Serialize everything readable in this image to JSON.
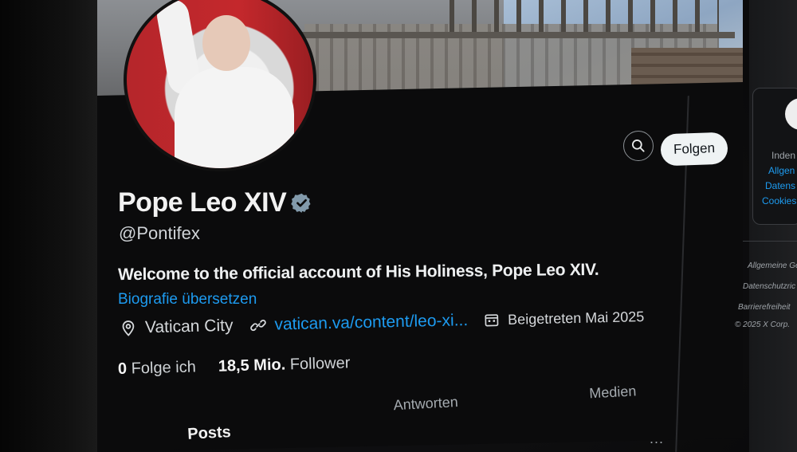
{
  "profile": {
    "display_name": "Pope Leo XIV",
    "handle": "@Pontifex",
    "bio": "Welcome to the official account of His Holiness, Pope Leo XIV.",
    "translate_bio": "Biografie übersetzen",
    "location": "Vatican City",
    "website": "vatican.va/content/leo-xi...",
    "joined": "Beigetreten Mai 2025",
    "following_count": "0",
    "following_label": "Folge ich",
    "followers_count": "18,5 Mio.",
    "followers_label": "Follower",
    "follow_button": "Folgen"
  },
  "tabs": [
    "Posts",
    "Antworten",
    "Medien"
  ],
  "more_label": "...",
  "sidebar": {
    "box_lines": [
      "Inden",
      "Allgen",
      "Datens",
      "Cookies"
    ],
    "footer_links": [
      "Allgemeine Ge",
      "Datenschutzric",
      "Barrierefreiheit"
    ],
    "copyright": "© 2025 X Corp."
  },
  "colors": {
    "accent": "#1d9bf0",
    "background": "#0b0b0c",
    "text": "#e7e9ea",
    "verified_badge": "#829aab"
  }
}
